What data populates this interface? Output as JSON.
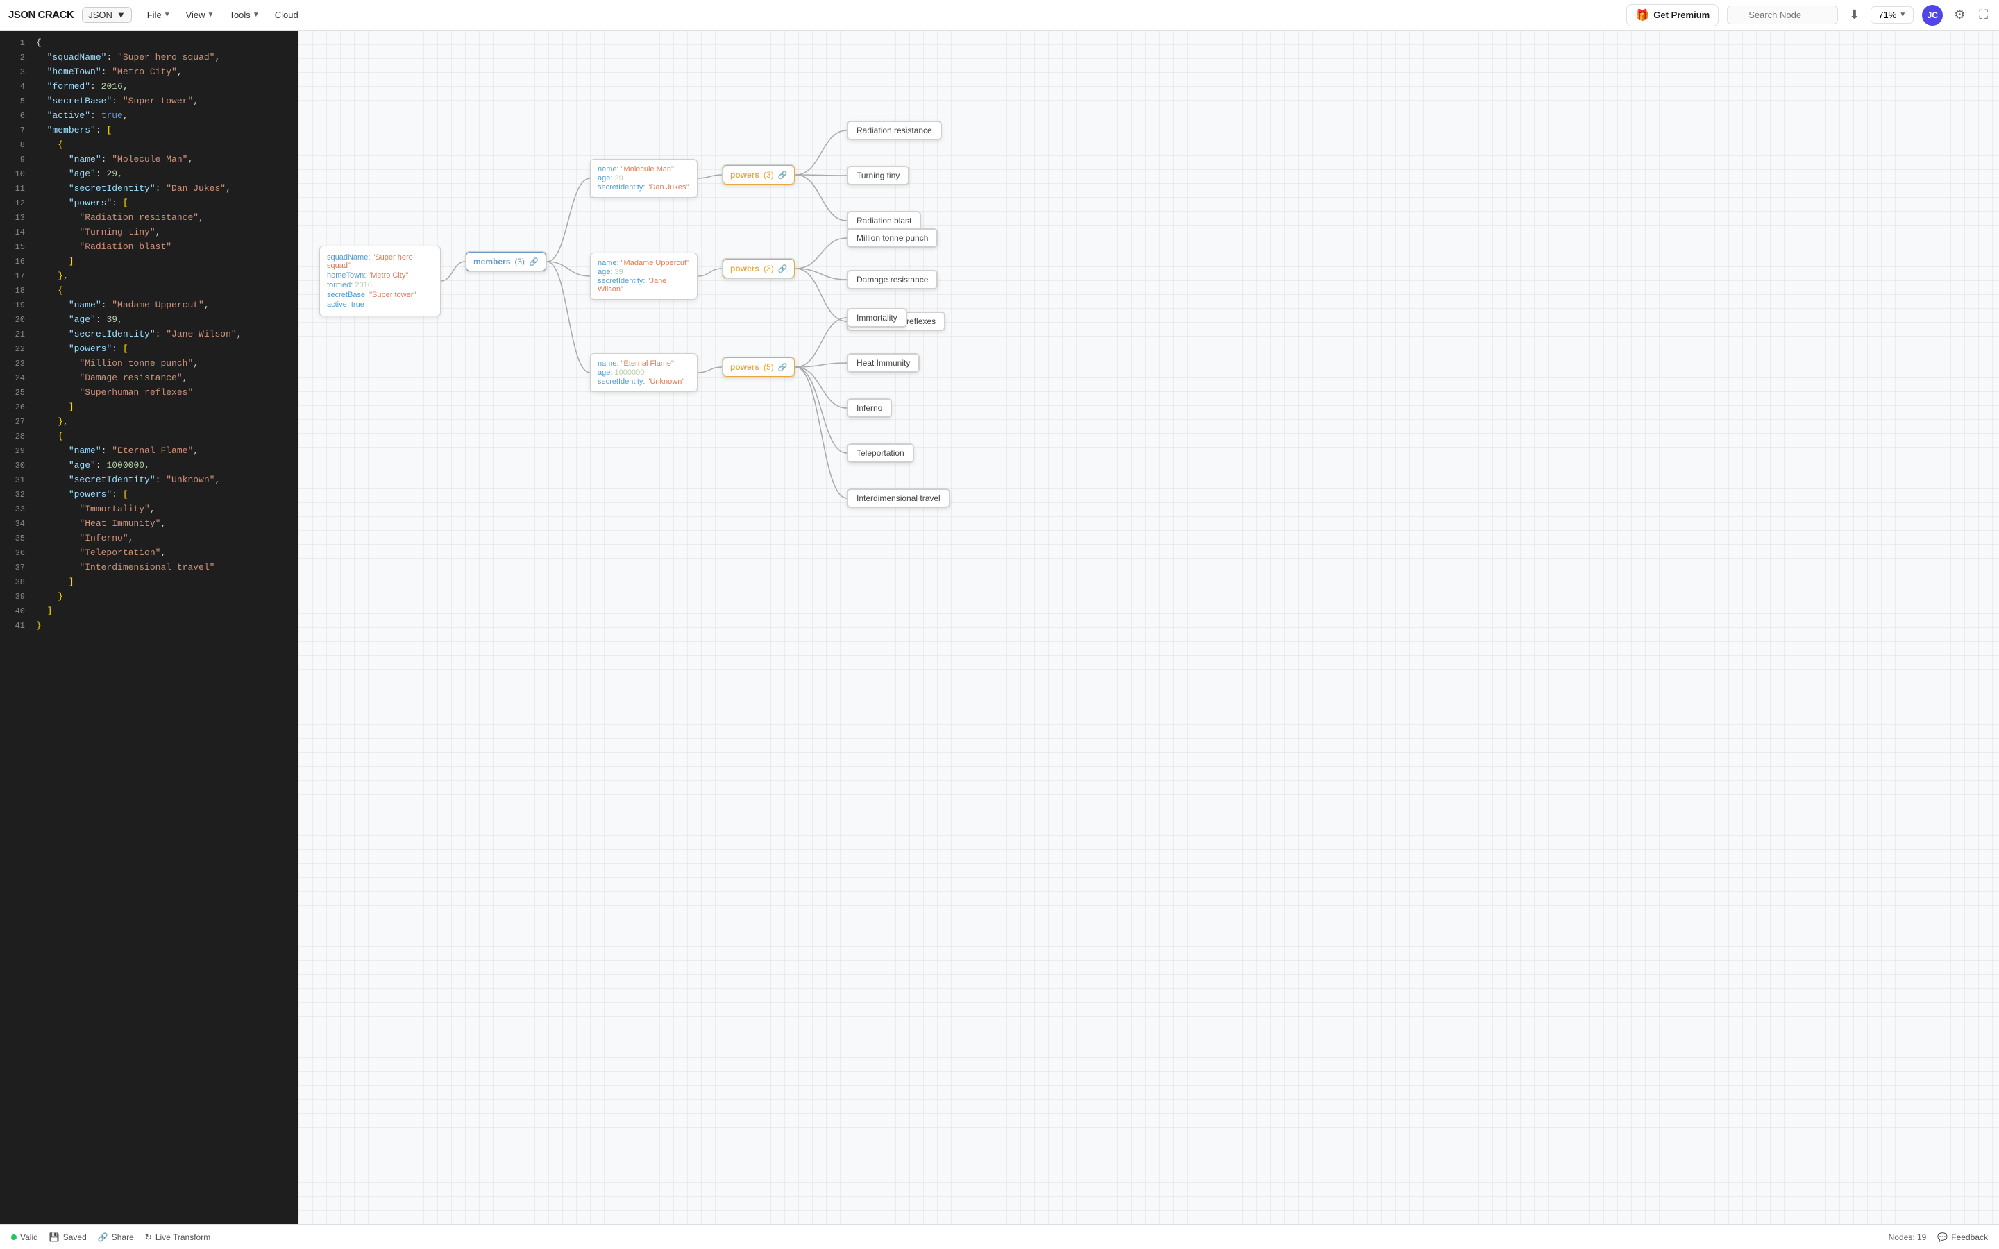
{
  "app": {
    "logo": "JSON CRACK",
    "format_selector": "JSON",
    "menus": [
      {
        "label": "File",
        "id": "file-menu"
      },
      {
        "label": "View",
        "id": "view-menu"
      },
      {
        "label": "Tools",
        "id": "tools-menu"
      },
      {
        "label": "Cloud",
        "id": "cloud-menu"
      }
    ],
    "premium_label": "Get Premium",
    "search_placeholder": "Search Node",
    "zoom_level": "71%",
    "user_initials": "JC"
  },
  "bottombar": {
    "valid_label": "Valid",
    "saved_label": "Saved",
    "share_label": "Share",
    "live_transform_label": "Live Transform",
    "nodes_count": "Nodes: 19",
    "feedback_label": "Feedback"
  },
  "json_data": {
    "squadName": "Super hero squad",
    "homeTown": "Metro City",
    "formed": 2016,
    "secretBase": "Super tower",
    "active": true,
    "members": [
      {
        "name": "Molecule Man",
        "age": 29,
        "secretIdentity": "Dan Jukes",
        "powers": [
          "Radiation resistance",
          "Turning tiny",
          "Radiation blast"
        ]
      },
      {
        "name": "Madame Uppercut",
        "age": 39,
        "secretIdentity": "Jane Wilson",
        "powers": [
          "Million tonne punch",
          "Damage resistance",
          "Superhuman reflexes"
        ]
      },
      {
        "name": "Eternal Flame",
        "age": 1000000,
        "secretIdentity": "Unknown",
        "powers": [
          "Immortality",
          "Heat Immunity",
          "Inferno",
          "Teleportation",
          "Interdimensional travel"
        ]
      }
    ]
  },
  "graph": {
    "root_node": {
      "props": [
        {
          "key": "squadName:",
          "val": "\"Super hero squad\""
        },
        {
          "key": "homeTown:",
          "val": "\"Metro City\""
        },
        {
          "key": "formed:",
          "val": "2016"
        },
        {
          "key": "secretBase:",
          "val": "\"Super tower\""
        },
        {
          "key": "active:",
          "val": "true"
        }
      ]
    },
    "members_btn": {
      "label": "members",
      "count": "(3)"
    },
    "members": [
      {
        "name_val": "\"Molecule Man\"",
        "age_val": "29",
        "secret_val": "\"Dan Jukes\"",
        "powers_count": "(3)",
        "powers": [
          "Radiation resistance",
          "Turning tiny",
          "Radiation blast"
        ]
      },
      {
        "name_val": "\"Madame Uppercut\"",
        "age_val": "39",
        "secret_val": "\"Jane Wilson\"",
        "powers_count": "(3)",
        "powers": [
          "Million tonne punch",
          "Damage resistance",
          "Superhuman reflexes"
        ]
      },
      {
        "name_val": "\"Eternal Flame\"",
        "age_val": "1000000",
        "secret_val": "\"Unknown\"",
        "powers_count": "(5)",
        "powers": [
          "Immortality",
          "Heat Immunity",
          "Inferno",
          "Teleportation",
          "Interdimensional travel"
        ]
      }
    ]
  }
}
